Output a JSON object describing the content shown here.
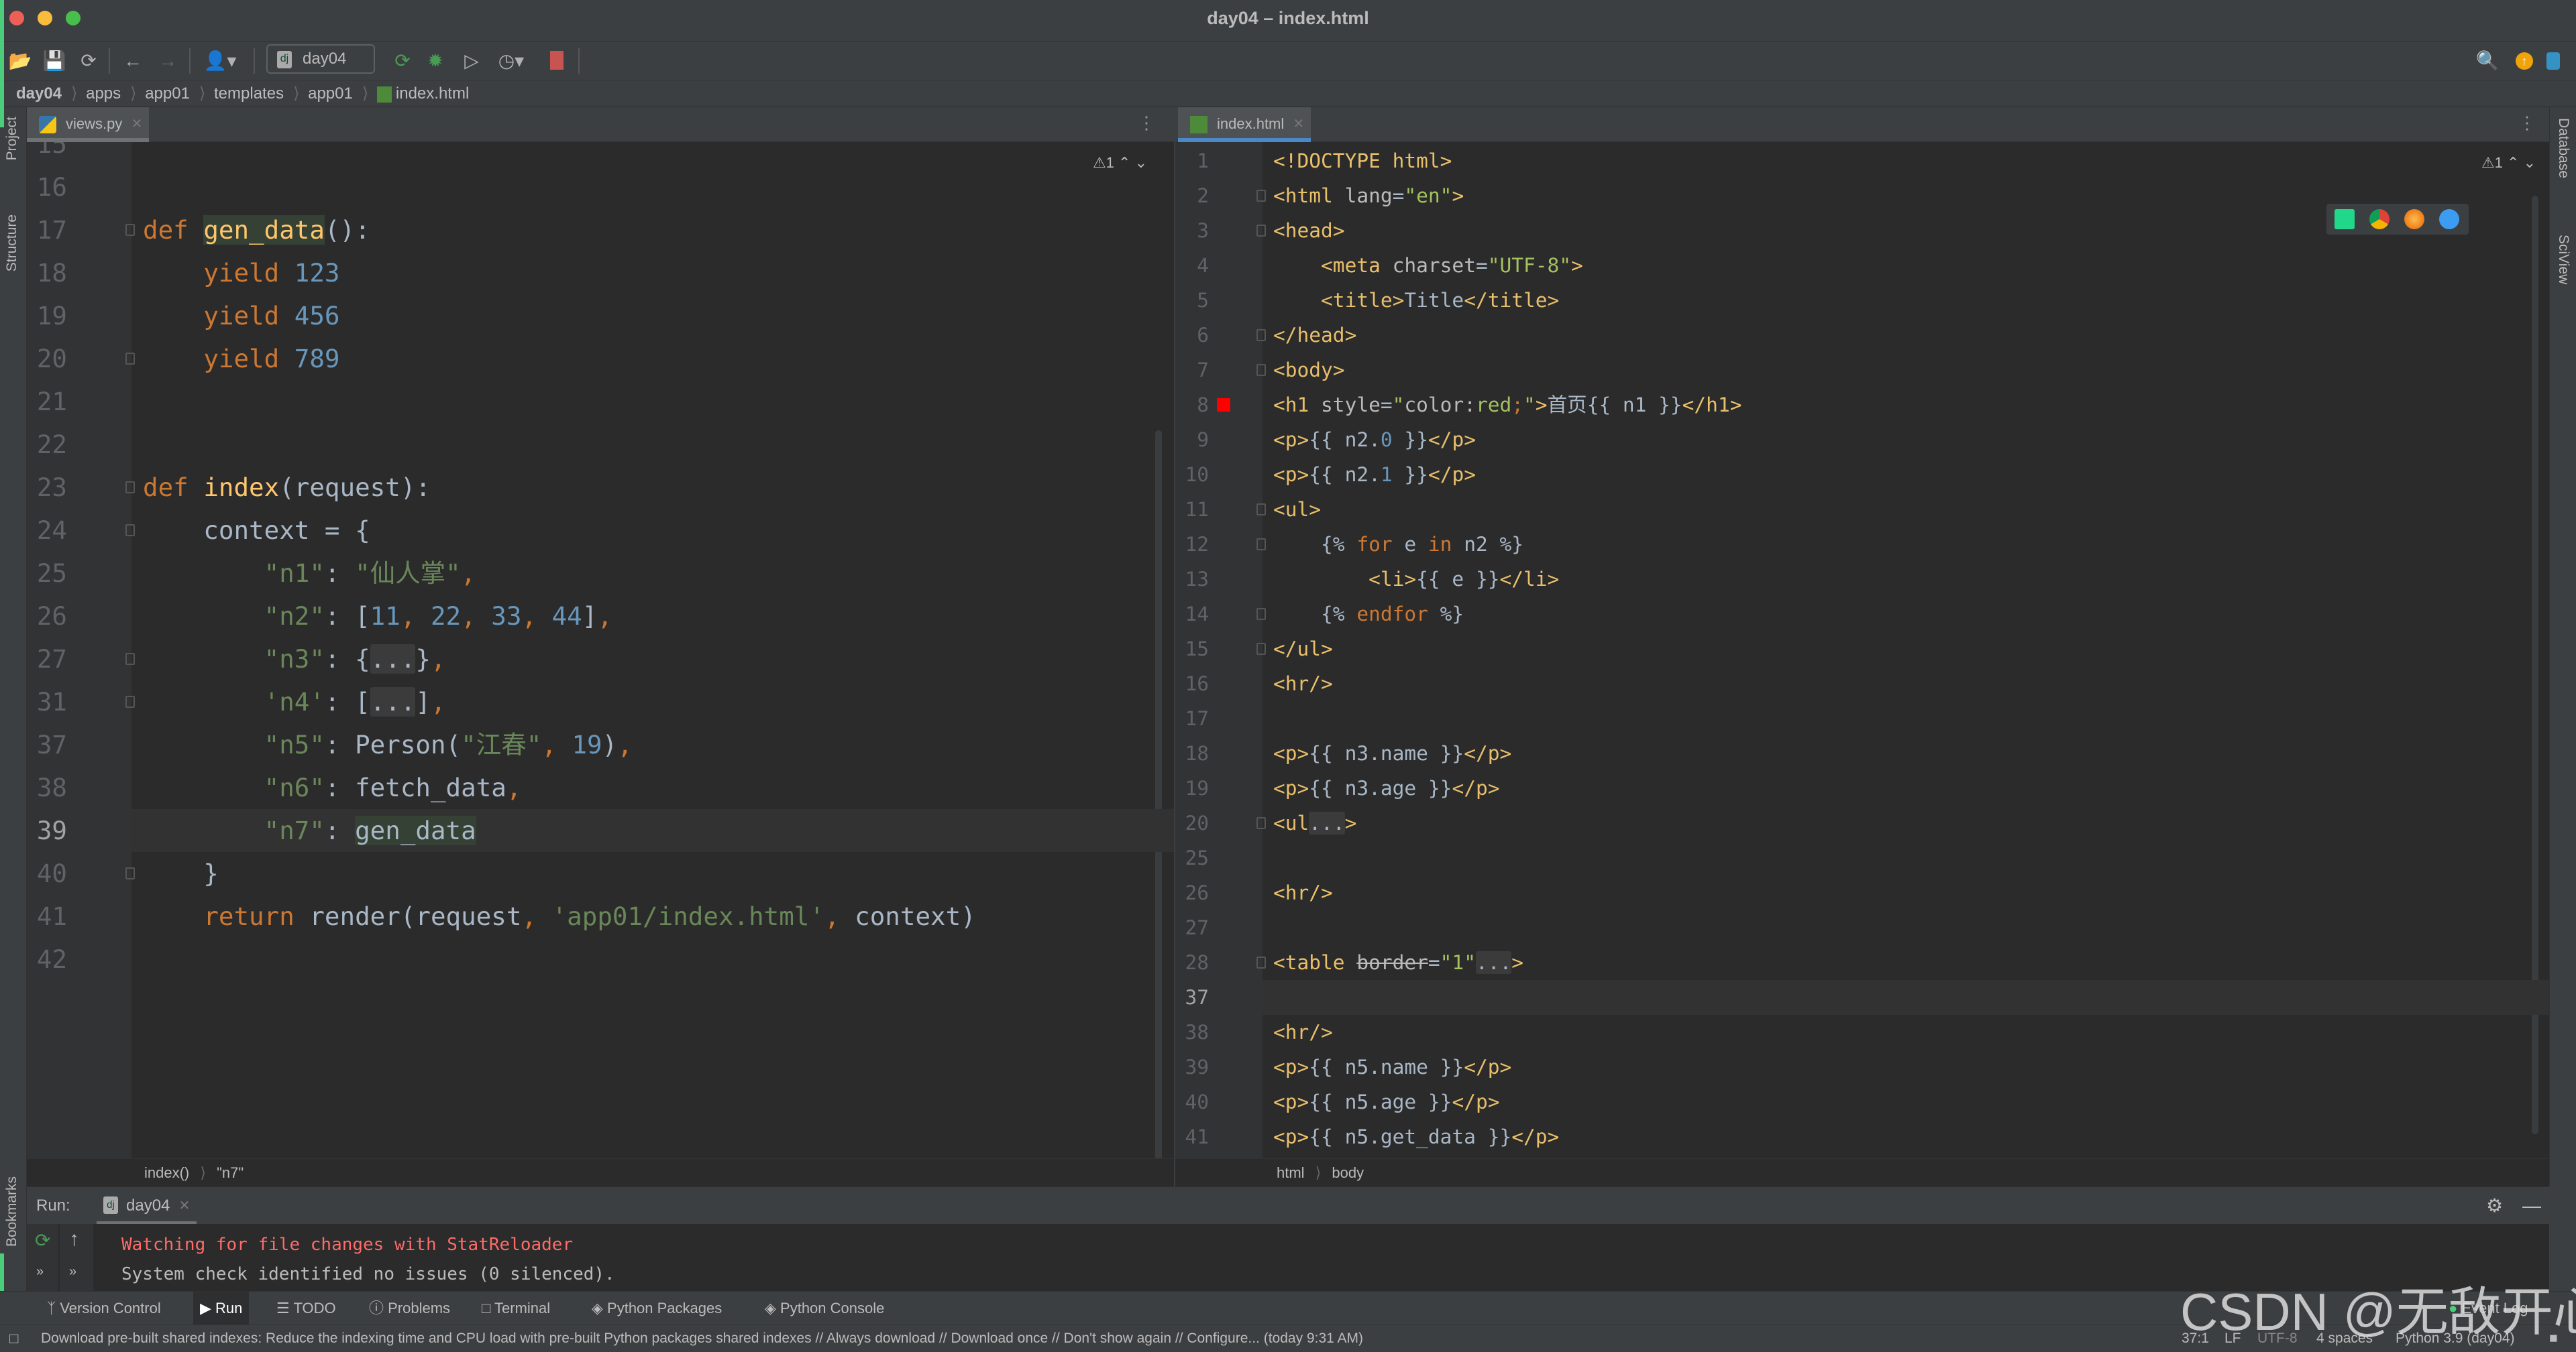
{
  "window": {
    "title": "day04 – index.html"
  },
  "toolbar": {
    "run_config": "day04",
    "icons": [
      "open-folder-icon",
      "save-icon",
      "sync-icon",
      "back-arrow-icon",
      "forward-arrow-icon",
      "user-icon",
      "rerun-icon",
      "debug-icon",
      "coverage-icon",
      "profile-icon",
      "stop-icon"
    ],
    "stop_color": "#c75450"
  },
  "breadcrumbs": [
    "day04",
    "apps",
    "app01",
    "templates",
    "app01",
    "index.html"
  ],
  "side": {
    "left": [
      "Project",
      "Structure",
      "Bookmarks"
    ],
    "right": [
      "Database",
      "SciView"
    ]
  },
  "left_editor": {
    "tab": "views.py",
    "warnings": "⚠1",
    "breadcrumb": [
      "index()",
      "\"n7\""
    ],
    "current_line": 39,
    "lines": [
      {
        "no": 15,
        "tokens": []
      },
      {
        "no": 16,
        "tokens": []
      },
      {
        "no": 17,
        "fold": true,
        "tokens": [
          [
            "k",
            "def "
          ],
          [
            "f hl",
            "gen_data"
          ],
          [
            "t",
            "():"
          ]
        ]
      },
      {
        "no": 18,
        "tokens": [
          [
            "t",
            "    "
          ],
          [
            "k",
            "yield "
          ],
          [
            "n",
            "123"
          ]
        ]
      },
      {
        "no": 19,
        "tokens": [
          [
            "t",
            "    "
          ],
          [
            "k",
            "yield "
          ],
          [
            "n",
            "456"
          ]
        ]
      },
      {
        "no": 20,
        "fold": true,
        "tokens": [
          [
            "t",
            "    "
          ],
          [
            "k",
            "yield "
          ],
          [
            "n",
            "789"
          ]
        ]
      },
      {
        "no": 21,
        "tokens": []
      },
      {
        "no": 22,
        "tokens": []
      },
      {
        "no": 23,
        "fold": true,
        "tokens": [
          [
            "k",
            "def "
          ],
          [
            "f",
            "index"
          ],
          [
            "t",
            "(request):"
          ]
        ]
      },
      {
        "no": 24,
        "fold": true,
        "tokens": [
          [
            "t",
            "    context = {"
          ]
        ]
      },
      {
        "no": 25,
        "tokens": [
          [
            "t",
            "        "
          ],
          [
            "s",
            "\"n1\""
          ],
          [
            "t",
            ": "
          ],
          [
            "s",
            "\"仙人掌\""
          ],
          [
            "k",
            ","
          ]
        ]
      },
      {
        "no": 26,
        "tokens": [
          [
            "t",
            "        "
          ],
          [
            "s",
            "\"n2\""
          ],
          [
            "t",
            ": ["
          ],
          [
            "n",
            "11"
          ],
          [
            "k",
            ", "
          ],
          [
            "n",
            "22"
          ],
          [
            "k",
            ", "
          ],
          [
            "n",
            "33"
          ],
          [
            "k",
            ", "
          ],
          [
            "n",
            "44"
          ],
          [
            "t",
            "]"
          ],
          [
            "k",
            ","
          ]
        ]
      },
      {
        "no": 27,
        "fold": true,
        "tokens": [
          [
            "t",
            "        "
          ],
          [
            "s",
            "\"n3\""
          ],
          [
            "t",
            ": {"
          ],
          [
            "fold",
            "..."
          ],
          [
            "t",
            "}"
          ],
          [
            "k",
            ","
          ]
        ]
      },
      {
        "no": 31,
        "fold": true,
        "tokens": [
          [
            "t",
            "        "
          ],
          [
            "s",
            "'n4'"
          ],
          [
            "t",
            ": ["
          ],
          [
            "fold",
            "..."
          ],
          [
            "t",
            "]"
          ],
          [
            "k",
            ","
          ]
        ]
      },
      {
        "no": 37,
        "tokens": [
          [
            "t",
            "        "
          ],
          [
            "s",
            "\"n5\""
          ],
          [
            "t",
            ": Person("
          ],
          [
            "s",
            "\"江春\""
          ],
          [
            "k",
            ", "
          ],
          [
            "n",
            "19"
          ],
          [
            "t",
            ")"
          ],
          [
            "k",
            ","
          ]
        ]
      },
      {
        "no": 38,
        "tokens": [
          [
            "t",
            "        "
          ],
          [
            "s",
            "\"n6\""
          ],
          [
            "t",
            ": fetch_data"
          ],
          [
            "k",
            ","
          ]
        ]
      },
      {
        "no": 39,
        "tokens": [
          [
            "t",
            "        "
          ],
          [
            "s",
            "\"n7\""
          ],
          [
            "t",
            ": "
          ],
          [
            "t hl",
            "gen_data"
          ]
        ]
      },
      {
        "no": 40,
        "fold": true,
        "tokens": [
          [
            "t",
            "    }"
          ]
        ]
      },
      {
        "no": 41,
        "tokens": [
          [
            "t",
            "    "
          ],
          [
            "k",
            "return "
          ],
          [
            "t",
            "render(request"
          ],
          [
            "k",
            ", "
          ],
          [
            "s",
            "'app01/index.html'"
          ],
          [
            "k",
            ", "
          ],
          [
            "t",
            "context)"
          ]
        ]
      },
      {
        "no": 42,
        "tokens": []
      }
    ]
  },
  "right_editor": {
    "tab": "index.html",
    "warnings": "⚠1",
    "breadcrumb": [
      "html",
      "body"
    ],
    "current_line": 37,
    "browser_icons": [
      "pycharm-icon",
      "chrome-icon",
      "firefox-icon",
      "safari-icon"
    ],
    "lines": [
      {
        "no": 1,
        "tokens": [
          [
            "tag",
            "<!DOCTYPE html>"
          ]
        ]
      },
      {
        "no": 2,
        "fold": true,
        "tokens": [
          [
            "tag",
            "<html "
          ],
          [
            "attr",
            "lang"
          ],
          [
            "t",
            "="
          ],
          [
            "val",
            "\"en\""
          ],
          [
            "tag",
            ">"
          ]
        ]
      },
      {
        "no": 3,
        "fold": true,
        "tokens": [
          [
            "tag",
            "<head>"
          ]
        ]
      },
      {
        "no": 4,
        "tokens": [
          [
            "t",
            "    "
          ],
          [
            "tag",
            "<meta "
          ],
          [
            "attr",
            "charset"
          ],
          [
            "t",
            "="
          ],
          [
            "val",
            "\"UTF-8\""
          ],
          [
            "tag",
            ">"
          ]
        ]
      },
      {
        "no": 5,
        "tokens": [
          [
            "t",
            "    "
          ],
          [
            "tag",
            "<title>"
          ],
          [
            "t",
            "Title"
          ],
          [
            "tag",
            "</title>"
          ]
        ]
      },
      {
        "no": 6,
        "fold": true,
        "tokens": [
          [
            "tag",
            "</head>"
          ]
        ]
      },
      {
        "no": 7,
        "fold": true,
        "tokens": [
          [
            "tag",
            "<body>"
          ]
        ]
      },
      {
        "no": 8,
        "breakpoint": true,
        "tokens": [
          [
            "tag",
            "<h1 "
          ],
          [
            "attr",
            "style"
          ],
          [
            "t",
            "="
          ],
          [
            "val",
            "\""
          ],
          [
            "attr",
            "color:"
          ],
          [
            "val",
            "red"
          ],
          [
            "k",
            ";"
          ],
          [
            "val",
            "\""
          ],
          [
            "tag",
            ">"
          ],
          [
            "t",
            "首页{{ n1 }}"
          ],
          [
            "tag",
            "</h1>"
          ]
        ]
      },
      {
        "no": 9,
        "tokens": [
          [
            "tag",
            "<p>"
          ],
          [
            "t",
            "{{ n2."
          ],
          [
            "n",
            "0"
          ],
          [
            "t",
            " }}"
          ],
          [
            "tag",
            "</p>"
          ]
        ]
      },
      {
        "no": 10,
        "tokens": [
          [
            "tag",
            "<p>"
          ],
          [
            "t",
            "{{ n2."
          ],
          [
            "n",
            "1"
          ],
          [
            "t",
            " }}"
          ],
          [
            "tag",
            "</p>"
          ]
        ]
      },
      {
        "no": 11,
        "fold": true,
        "tokens": [
          [
            "tag",
            "<ul>"
          ]
        ]
      },
      {
        "no": 12,
        "fold": true,
        "tokens": [
          [
            "t",
            "    {% "
          ],
          [
            "tk",
            "for "
          ],
          [
            "t",
            "e "
          ],
          [
            "tk",
            "in "
          ],
          [
            "t",
            "n2 %}"
          ]
        ]
      },
      {
        "no": 13,
        "tokens": [
          [
            "t",
            "        "
          ],
          [
            "tag",
            "<li>"
          ],
          [
            "t",
            "{{ e }}"
          ],
          [
            "tag",
            "</li>"
          ]
        ]
      },
      {
        "no": 14,
        "fold": true,
        "tokens": [
          [
            "t",
            "    {% "
          ],
          [
            "tk",
            "endfor "
          ],
          [
            "t",
            "%}"
          ]
        ]
      },
      {
        "no": 15,
        "fold": true,
        "tokens": [
          [
            "tag",
            "</ul>"
          ]
        ]
      },
      {
        "no": 16,
        "tokens": [
          [
            "tag",
            "<hr/>"
          ]
        ]
      },
      {
        "no": 17,
        "tokens": []
      },
      {
        "no": 18,
        "tokens": [
          [
            "tag",
            "<p>"
          ],
          [
            "t",
            "{{ n3.name }}"
          ],
          [
            "tag",
            "</p>"
          ]
        ]
      },
      {
        "no": 19,
        "tokens": [
          [
            "tag",
            "<p>"
          ],
          [
            "t",
            "{{ n3.age }}"
          ],
          [
            "tag",
            "</p>"
          ]
        ]
      },
      {
        "no": 20,
        "fold": true,
        "tokens": [
          [
            "tag",
            "<ul"
          ],
          [
            "fold",
            "..."
          ],
          [
            "tag",
            ">"
          ]
        ]
      },
      {
        "no": 25,
        "tokens": []
      },
      {
        "no": 26,
        "tokens": [
          [
            "tag",
            "<hr/>"
          ]
        ]
      },
      {
        "no": 27,
        "tokens": []
      },
      {
        "no": 28,
        "fold": true,
        "tokens": [
          [
            "tag",
            "<table "
          ],
          [
            "strike",
            "border"
          ],
          [
            "t",
            "="
          ],
          [
            "val",
            "\"1\""
          ],
          [
            "fold",
            "..."
          ],
          [
            "tag",
            ">"
          ]
        ]
      },
      {
        "no": 37,
        "tokens": []
      },
      {
        "no": 38,
        "tokens": [
          [
            "tag",
            "<hr/>"
          ]
        ]
      },
      {
        "no": 39,
        "tokens": [
          [
            "tag",
            "<p>"
          ],
          [
            "t",
            "{{ n5.name }}"
          ],
          [
            "tag",
            "</p>"
          ]
        ]
      },
      {
        "no": 40,
        "tokens": [
          [
            "tag",
            "<p>"
          ],
          [
            "t",
            "{{ n5.age }}"
          ],
          [
            "tag",
            "</p>"
          ]
        ]
      },
      {
        "no": 41,
        "tokens": [
          [
            "tag",
            "<p>"
          ],
          [
            "t",
            "{{ n5.get_data }}"
          ],
          [
            "tag",
            "</p>"
          ]
        ]
      }
    ]
  },
  "run": {
    "label": "Run:",
    "tab": "day04",
    "output": [
      {
        "text": "Watching for file changes with StatReloader",
        "color": "#ff6b68"
      },
      {
        "text": "System check identified no issues (0 silenced).",
        "color": "#bbbbbb"
      }
    ]
  },
  "bottom_tools": [
    "Version Control",
    "Run",
    "TODO",
    "Problems",
    "Terminal",
    "Python Packages",
    "Python Console"
  ],
  "event_log": "Event Log",
  "status": {
    "message": "Download pre-built shared indexes: Reduce the indexing time and CPU load with pre-built Python packages shared indexes // Always download // Download once // Don't show again // Configure... (today 9:31 AM)",
    "position": "37:1",
    "line_sep": "LF",
    "encoding": "UTF-8",
    "indent": "4 spaces",
    "interpreter": "Python 3.9 (day04)"
  },
  "watermark": "CSDN @无敌开心"
}
